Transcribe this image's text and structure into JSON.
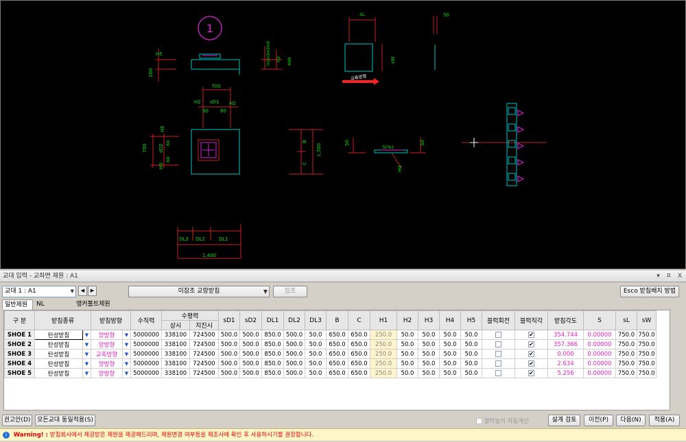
{
  "drawing": {
    "circle_label": "1",
    "elevation_labels": [
      "H5",
      "200",
      "H1H2H3H4",
      "H2",
      "400"
    ],
    "plan_labels": [
      "sL",
      "sW",
      "교축방향"
    ],
    "side_labels": [
      "50"
    ],
    "top_labels": [
      "700",
      "H2",
      "sD1",
      "H2",
      "60",
      "60"
    ],
    "left_labels": [
      "H5",
      "700",
      "sD2",
      "H5",
      "60",
      "60"
    ],
    "section_labels": [
      "B",
      "C",
      "1,300"
    ],
    "slope_labels": [
      "50",
      "S(%)",
      "50",
      "H4"
    ],
    "bottom_labels": [
      "DL3",
      "DL2",
      "DL1",
      "1,400"
    ]
  },
  "panel": {
    "title": "교대 입력 - 교좌면 제원 : A1",
    "title_buttons": [
      "▾",
      "ㅍ",
      "X"
    ]
  },
  "toolbar": {
    "abutment_select": "교대 1 : A1",
    "bearing_type_select": "미참조 교량받침",
    "ref_button": "참조",
    "esco_button": "Esco 받침배치 방법"
  },
  "tabs": [
    "일반제원",
    "NL Property",
    "앵커볼트제원"
  ],
  "table": {
    "headers": {
      "gubun": "구 분",
      "type": "받침종류",
      "dir": "받침방향",
      "vert": "수직력",
      "horiz": "수평력",
      "horiz_normal": "상시",
      "horiz_eq": "지진시",
      "cols": [
        "sD1",
        "sD2",
        "DL1",
        "DL2",
        "DL3",
        "B",
        "C",
        "H1",
        "H2",
        "H3",
        "H4",
        "H5"
      ],
      "block_rot": "블럭회전",
      "block_right": "블럭직각",
      "angle": "받침각도",
      "s": "S",
      "sl": "sL",
      "sw": "sW"
    },
    "rows": [
      {
        "name": "SHOE 1",
        "type": "탄성받침",
        "dir": "양방향",
        "vert": "5000000",
        "normal": "338100",
        "eq": "724500",
        "vals": [
          "500.0",
          "500.0",
          "850.0",
          "500.0",
          "50.0",
          "650.0",
          "650.0",
          "250.0",
          "50.0",
          "50.0",
          "50.0",
          "50.0"
        ],
        "rot": false,
        "right": true,
        "angle": "354.744",
        "s": "0.00000",
        "sl": "750.0",
        "sw": "750.0"
      },
      {
        "name": "SHOE 2",
        "type": "탄성받침",
        "dir": "양방향",
        "vert": "5000000",
        "normal": "338100",
        "eq": "724500",
        "vals": [
          "500.0",
          "500.0",
          "850.0",
          "500.0",
          "50.0",
          "650.0",
          "650.0",
          "250.0",
          "50.0",
          "50.0",
          "50.0",
          "50.0"
        ],
        "rot": false,
        "right": true,
        "angle": "357.366",
        "s": "0.00000",
        "sl": "750.0",
        "sw": "750.0"
      },
      {
        "name": "SHOE 3",
        "type": "탄성받침",
        "dir": "교축방향",
        "vert": "5000000",
        "normal": "338100",
        "eq": "724500",
        "vals": [
          "500.0",
          "500.0",
          "850.0",
          "500.0",
          "50.0",
          "650.0",
          "650.0",
          "250.0",
          "50.0",
          "50.0",
          "50.0",
          "50.0"
        ],
        "rot": false,
        "right": true,
        "angle": "0.000",
        "s": "0.00000",
        "sl": "750.0",
        "sw": "750.0"
      },
      {
        "name": "SHOE 4",
        "type": "탄성받침",
        "dir": "양방향",
        "vert": "5000000",
        "normal": "338100",
        "eq": "724500",
        "vals": [
          "500.0",
          "500.0",
          "850.0",
          "500.0",
          "50.0",
          "650.0",
          "650.0",
          "250.0",
          "50.0",
          "50.0",
          "50.0",
          "50.0"
        ],
        "rot": false,
        "right": true,
        "angle": "2.634",
        "s": "0.00000",
        "sl": "750.0",
        "sw": "750.0"
      },
      {
        "name": "SHOE 5",
        "type": "탄성받침",
        "dir": "양방향",
        "vert": "5000000",
        "normal": "338100",
        "eq": "724500",
        "vals": [
          "500.0",
          "500.0",
          "850.0",
          "500.0",
          "50.0",
          "650.0",
          "650.0",
          "250.0",
          "50.0",
          "50.0",
          "50.0",
          "50.0"
        ],
        "rot": false,
        "right": true,
        "angle": "5.256",
        "s": "0.00000",
        "sl": "750.0",
        "sw": "750.0"
      }
    ]
  },
  "bottom": {
    "recommend_button": "권고안(D)",
    "apply_all_button": "모든교대 동일적용(S)",
    "auto_calc_label": "블럭높이 자동계산",
    "design_check_button": "설계 검토",
    "prev_button": "이전(P)",
    "next_button": "다음(N)",
    "apply_button": "적용(A)"
  },
  "warning": {
    "prefix": "Warning! :",
    "text": "받침회사에서 제공받은 제원을 제공해드리며, 제원변경 여부등을 제조사에 확인 후 사용하시기를 권장합니다."
  },
  "colors": {
    "cad_bg": "#000000",
    "cad_line": "#00c8c8",
    "cad_dim": "#cc2020",
    "cad_text": "#00e000",
    "magenta": "#e020e0",
    "arrow": "#ff2020"
  }
}
